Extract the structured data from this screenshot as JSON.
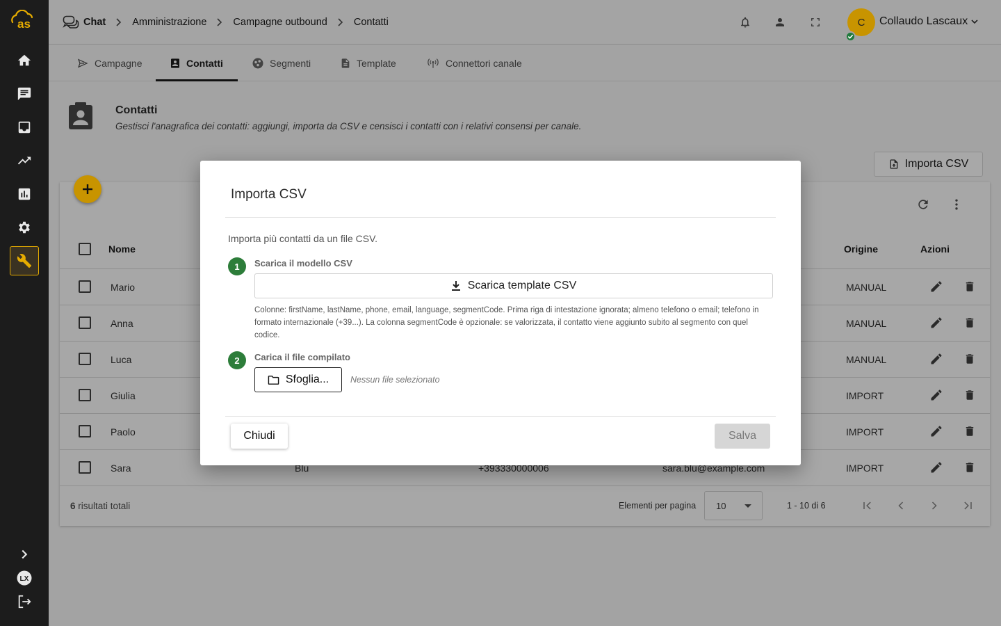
{
  "breadcrumb": {
    "items": [
      "Chat",
      "Amministrazione",
      "Campagne outbound",
      "Contatti"
    ]
  },
  "user": {
    "initial": "C",
    "name": "Collaudo Lascaux"
  },
  "tabs": [
    {
      "label": "Campagne"
    },
    {
      "label": "Contatti"
    },
    {
      "label": "Segmenti"
    },
    {
      "label": "Template"
    },
    {
      "label": "Connettori canale"
    }
  ],
  "page": {
    "title": "Contatti",
    "description": "Gestisci l'anagrafica dei contatti: aggiungi, importa da CSV e censisci i contatti con i relativi consensi per canale.",
    "import_button": "Importa CSV"
  },
  "table": {
    "columns": {
      "name": "Nome",
      "origin": "Origine",
      "actions": "Azioni"
    },
    "rows": [
      {
        "name": "Mario",
        "origin": "MANUAL"
      },
      {
        "name": "Anna",
        "origin": "MANUAL"
      },
      {
        "name": "Luca",
        "origin": "MANUAL"
      },
      {
        "name": "Giulia",
        "origin": "IMPORT"
      },
      {
        "name": "Paolo",
        "origin": "IMPORT"
      },
      {
        "name": "Sara",
        "surname": "Blu",
        "phone": "+393330000006",
        "email": "sara.blu@example.com",
        "origin": "IMPORT"
      }
    ],
    "total_count": "6",
    "total_suffix": "risultati totali",
    "per_page_label": "Elementi per pagina",
    "per_page_value": "10",
    "range": "1 - 10 di 6"
  },
  "modal": {
    "title": "Importa CSV",
    "intro": "Importa più contatti da un file CSV.",
    "step1": {
      "number": "1",
      "label": "Scarica il modello CSV",
      "button": "Scarica template CSV"
    },
    "help": "Colonne: firstName, lastName, phone, email, language, segmentCode. Prima riga di intestazione ignorata; almeno telefono o email; telefono in formato internazionale (+39...). La colonna segmentCode è opzionale: se valorizzata, il contatto viene aggiunto subito al segmento con quel codice.",
    "step2": {
      "number": "2",
      "label": "Carica il file compilato",
      "button": "Sfoglia...",
      "no_file": "Nessun file selezionato"
    },
    "close": "Chiudi",
    "save": "Salva"
  },
  "colors": {
    "accent": "#c89400",
    "step_green": "#2d7d3a",
    "rail_bg": "#1c1c1c"
  },
  "icons": [
    "cloud-logo-icon",
    "home-icon",
    "chat-icon",
    "inbox-icon",
    "trend-icon",
    "bar-chart-icon",
    "gear-icon",
    "wrench-icon",
    "chevron-right-icon",
    "lx-logo-icon",
    "logout-icon",
    "bell-icon",
    "person-icon",
    "fullscreen-icon",
    "check-icon",
    "send-icon",
    "contact-card-icon",
    "segments-icon",
    "document-icon",
    "antenna-icon",
    "file-upload-icon",
    "plus-icon",
    "refresh-icon",
    "more-vert-icon",
    "edit-icon",
    "trash-icon",
    "download-icon",
    "folder-icon"
  ]
}
